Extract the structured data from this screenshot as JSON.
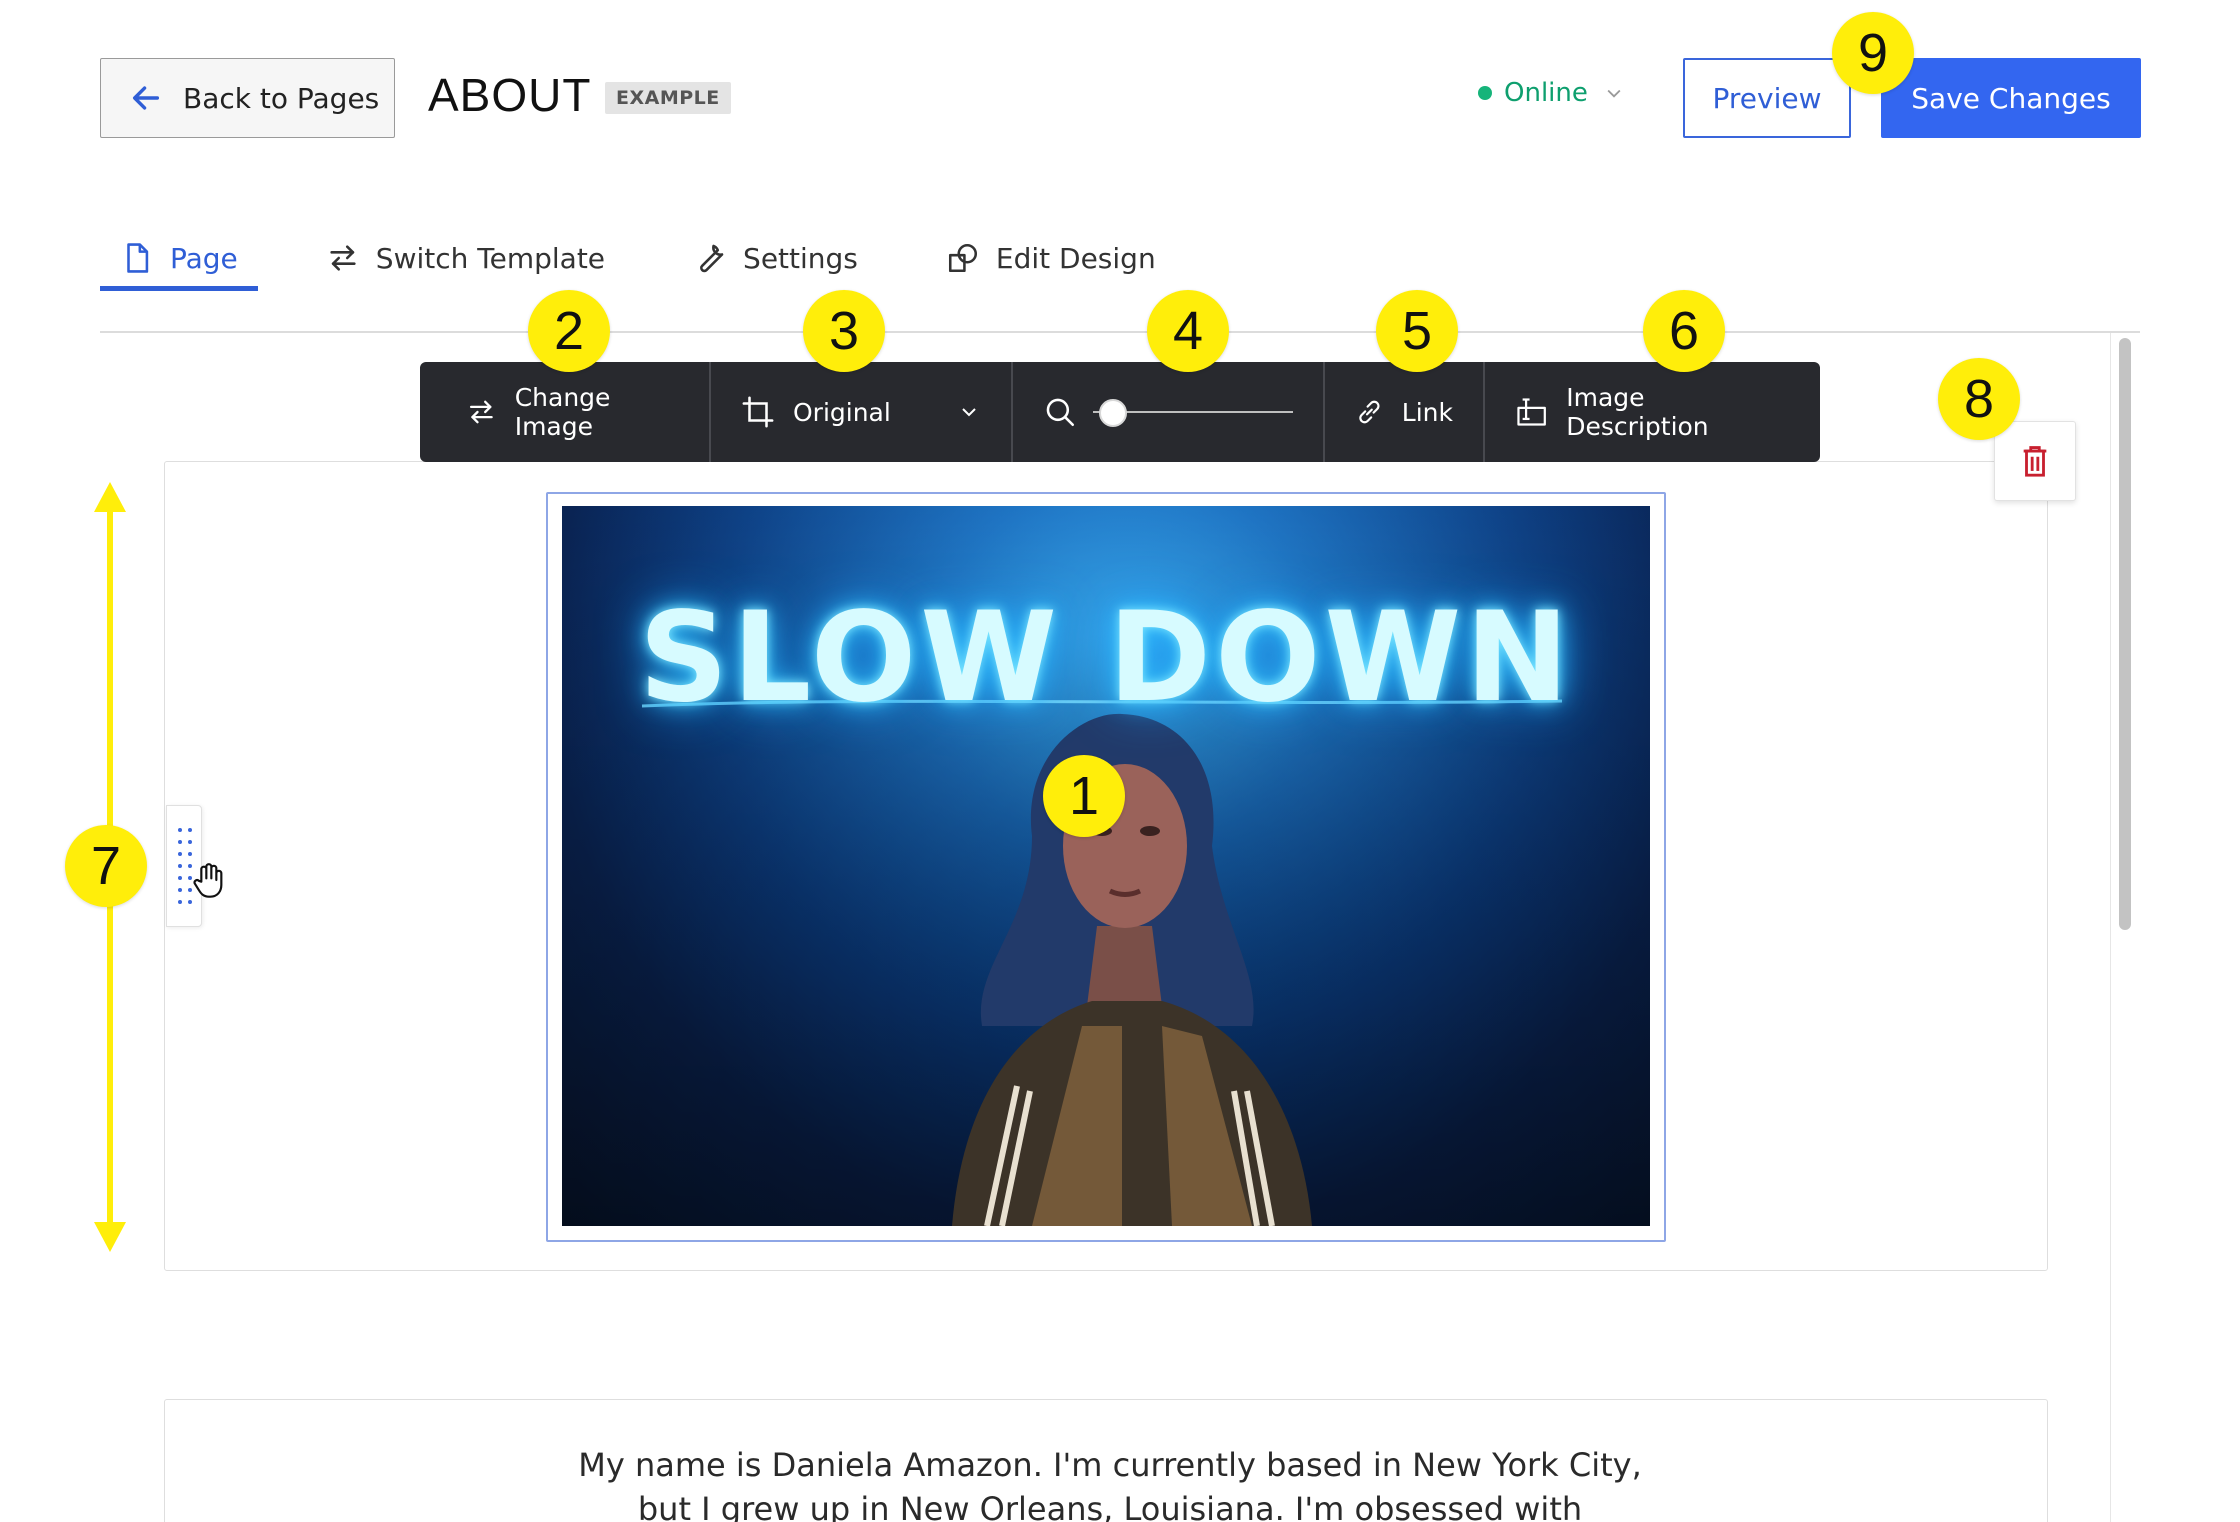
{
  "header": {
    "back_label": "Back to Pages",
    "page_title": "ABOUT",
    "badge": "EXAMPLE",
    "status": "Online",
    "preview_label": "Preview",
    "save_label": "Save Changes"
  },
  "tabs": [
    {
      "label": "Page",
      "icon": "page-icon",
      "active": true
    },
    {
      "label": "Switch Template",
      "icon": "switch-icon",
      "active": false
    },
    {
      "label": "Settings",
      "icon": "wrench-icon",
      "active": false
    },
    {
      "label": "Edit Design",
      "icon": "design-icon",
      "active": false
    }
  ],
  "toolbar": {
    "change_image_label": "Change Image",
    "crop_label": "Original",
    "zoom_level": 0.1,
    "link_label": "Link",
    "description_label": "Image Description"
  },
  "image": {
    "neon_sign": "SLOW DOWN"
  },
  "callouts": [
    "1",
    "2",
    "3",
    "4",
    "5",
    "6",
    "7",
    "8",
    "9"
  ],
  "bio": {
    "text": "My name is Daniela Amazon. I'm currently based in New York City, but I grew up in New Orleans, Louisiana. I'm obsessed with photography and"
  },
  "colors": {
    "accent": "#3366f0",
    "status_online": "#16b47a",
    "toolbar_bg": "#28292e",
    "callout": "#ffee0a",
    "delete": "#c8202f"
  }
}
